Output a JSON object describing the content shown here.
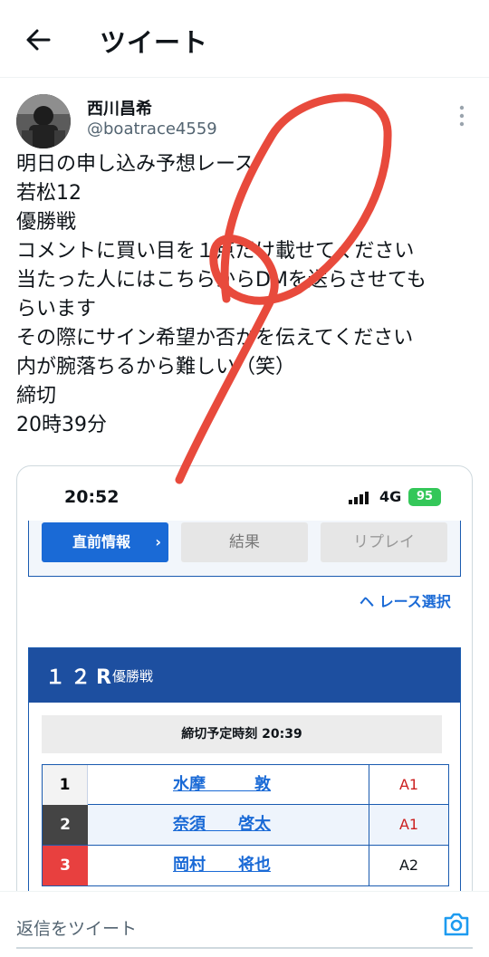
{
  "header": {
    "title": "ツイート"
  },
  "user": {
    "name": "西川昌希",
    "handle": "@boatrace4559"
  },
  "tweet": {
    "lines": [
      "明日の申し込み予想レース",
      "若松12",
      "優勝戦",
      "コメントに買い目を１点だけ載せてください",
      "当たった人にはこちらからDMを送らさせても",
      "らいます",
      "その際にサイン希望か否かを伝えてください",
      "内が腕落ちるから難しい（笑）",
      "締切",
      "20時39分"
    ]
  },
  "media": {
    "status": {
      "time": "20:52",
      "network": "4G",
      "battery": "95"
    },
    "buttons": {
      "chokuzen": "直前情報",
      "chokuzen_chevron": "›",
      "kekka": "結果",
      "replay": "リプレイ"
    },
    "race_select": "ヘ レース選択",
    "race": {
      "number": "１２R",
      "name": "優勝戦",
      "deadline": "締切予定時刻 20:39",
      "entries": [
        {
          "lane": "1",
          "name": "水摩　　　敦",
          "class": "A1"
        },
        {
          "lane": "2",
          "name": "奈須　　啓太",
          "class": "A1"
        },
        {
          "lane": "3",
          "name": "岡村　　将也",
          "class": "A2"
        }
      ]
    }
  },
  "reply": {
    "placeholder": "返信をツイート"
  },
  "icons": {
    "back": "back-arrow-icon",
    "more": "more-vertical-icon",
    "camera": "camera-icon",
    "signal": "signal-icon",
    "battery": "battery-icon"
  },
  "colors": {
    "accent": "#1d9bf0",
    "race_blue": "#1d4fa0",
    "link_blue": "#1a6ad6",
    "scribble_red": "#e84a3c"
  }
}
